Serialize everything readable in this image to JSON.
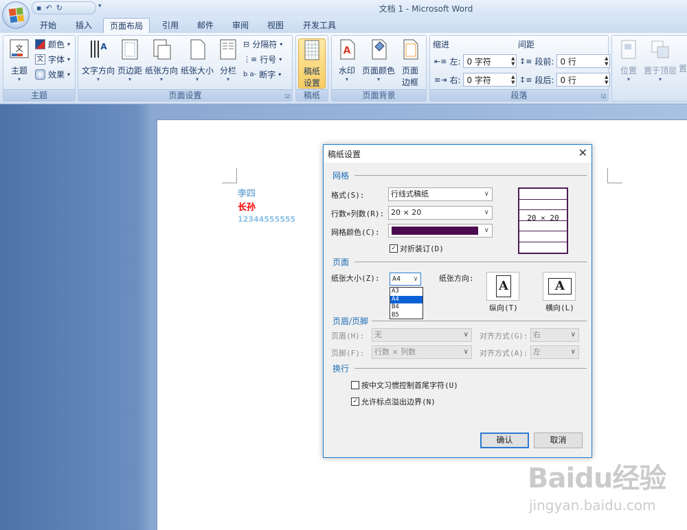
{
  "window": {
    "title": "文档 1 - Microsoft Word"
  },
  "qat": {
    "save_icon": "save-icon",
    "undo_icon": "undo-icon",
    "redo_icon": "redo-icon",
    "more": "▾"
  },
  "tabs": [
    "开始",
    "插入",
    "页面布局",
    "引用",
    "邮件",
    "审阅",
    "视图",
    "开发工具"
  ],
  "active_tab": "页面布局",
  "ribbon": {
    "theme_group": {
      "label": "主题",
      "themes_button": "主题",
      "colors": "颜色",
      "fonts": "字体",
      "effects": "效果"
    },
    "page_setup_group": {
      "label": "页面设置",
      "text_direction": "文字方向",
      "margins": "页边距",
      "orientation": "纸张方向",
      "size": "纸张大小",
      "columns": "分栏",
      "breaks": "分隔符",
      "line_numbers": "行号",
      "hyphenation": "断字"
    },
    "manuscript_group": {
      "label": "稿纸",
      "button_line1": "稿纸",
      "button_line2": "设置"
    },
    "page_background_group": {
      "label": "页面背景",
      "watermark": "水印",
      "page_color": "页面颜色",
      "page_borders_line1": "页面",
      "page_borders_line2": "边框"
    },
    "paragraph_group": {
      "label": "段落",
      "indent_title": "缩进",
      "indent_left_label": "左:",
      "indent_left_value": "0 字符",
      "indent_right_label": "右:",
      "indent_right_value": "0 字符",
      "spacing_title": "间距",
      "spacing_before_label": "段前:",
      "spacing_before_value": "0 行",
      "spacing_after_label": "段后:",
      "spacing_after_value": "0 行"
    },
    "arrange_group": {
      "position": "位置",
      "bring_to_front": "置于顶层",
      "cut_off": "置"
    }
  },
  "document": {
    "line1": "李四",
    "line2": "长孙",
    "line3": "12344555555",
    "colors": {
      "line1": "#7fb3d9",
      "line2": "#ff0000",
      "line3": "#8cc2e6"
    }
  },
  "dialog": {
    "title": "稿纸设置",
    "grid_section": "网格",
    "style_label": "格式(S):",
    "style_value": "行线式稿纸",
    "rows_cols_label": "行数×列数(R):",
    "rows_cols_value": "20 × 20",
    "grid_color_label": "网格颜色(C):",
    "grid_color": "#4b0a4f",
    "fold_binding_label": "对折装订(D)",
    "fold_binding_checked": true,
    "preview_text": "20 × 20",
    "page_section": "页面",
    "paper_size_label": "纸张大小(Z):",
    "paper_size_value": "A4",
    "paper_size_options": [
      "A3",
      "A4",
      "B4",
      "B5"
    ],
    "paper_size_highlight": "A4",
    "orientation_label": "纸张方向:",
    "portrait_label": "纵向(T)",
    "landscape_label": "横向(L)",
    "orientation_glyph": "A",
    "header_footer_section": "页眉/页脚",
    "header_label": "页眉(H):",
    "header_value": "无",
    "header_align_label": "对齐方式(G):",
    "header_align_value": "右",
    "footer_label": "页脚(F):",
    "footer_value": "行数 × 列数",
    "footer_align_label": "对齐方式(A):",
    "footer_align_value": "左",
    "wrap_section": "换行",
    "chinese_rule_label": "按中文习惯控制首尾字符(U)",
    "chinese_rule_checked": false,
    "punct_overflow_label": "允许标点溢出边界(N)",
    "punct_overflow_checked": true,
    "ok": "确认",
    "cancel": "取消"
  },
  "watermark": {
    "brand": "Baidu经验",
    "url": "jingyan.baidu.com"
  }
}
